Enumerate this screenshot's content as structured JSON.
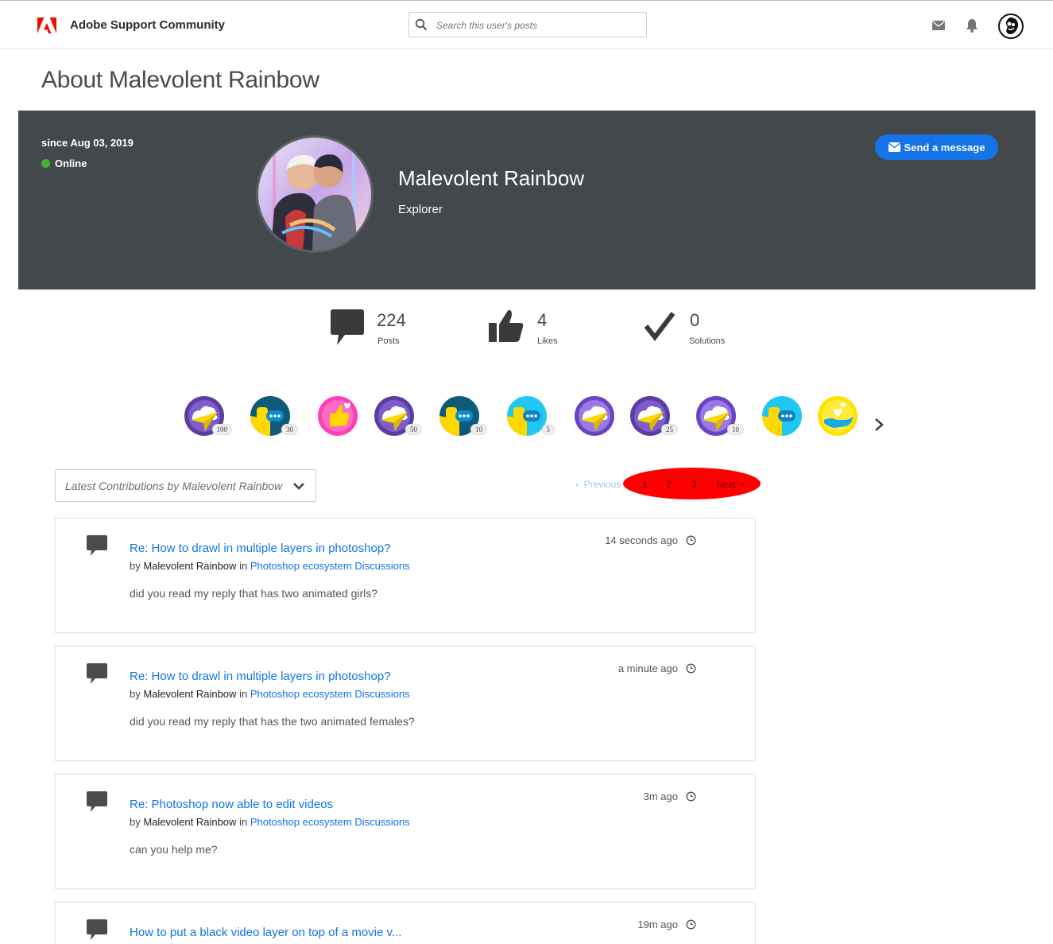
{
  "header": {
    "brand": "Adobe Support Community",
    "search_placeholder": "Search this user's posts"
  },
  "page_title": "About Malevolent Rainbow",
  "profile": {
    "since": "since Aug 03, 2019",
    "status": "Online",
    "name": "Malevolent Rainbow",
    "rank": "Explorer",
    "send_message": "Send a message"
  },
  "stats": [
    {
      "value": "224",
      "label": "Posts"
    },
    {
      "value": "4",
      "label": "Likes"
    },
    {
      "value": "0",
      "label": "Solutions"
    }
  ],
  "badges": [
    {
      "icon": "paper-plane-icon",
      "count": "100"
    },
    {
      "icon": "chat-bubble-icon",
      "count": "30"
    },
    {
      "icon": "thumbs-up-heart-icon",
      "count": ""
    },
    {
      "icon": "paper-plane-icon",
      "count": "50"
    },
    {
      "icon": "chat-bubble-icon",
      "count": "10"
    },
    {
      "icon": "chat-bubble-icon",
      "count": "5"
    },
    {
      "icon": "paper-plane-icon",
      "count": ""
    },
    {
      "icon": "paper-plane-icon",
      "count": "25"
    },
    {
      "icon": "paper-plane-icon",
      "count": "10"
    },
    {
      "icon": "chat-bubble-icon",
      "count": ""
    },
    {
      "icon": "helping-hand-icon",
      "count": ""
    }
  ],
  "filter": {
    "label": "Latest Contributions by Malevolent Rainbow"
  },
  "pagination": {
    "prev": "Previous",
    "pages": [
      "1",
      "2",
      "3"
    ],
    "next": "Next"
  },
  "contributions": [
    {
      "title": "Re: How to drawl in multiple layers in photoshop?",
      "by": "by",
      "author": "Malevolent Rainbow",
      "in": "in",
      "board": "Photoshop ecosystem Discussions",
      "excerpt": "did you read my reply that has two animated girls?",
      "time": "14 seconds ago"
    },
    {
      "title": "Re: How to drawl in multiple layers in photoshop?",
      "by": "by",
      "author": "Malevolent Rainbow",
      "in": "in",
      "board": "Photoshop ecosystem Discussions",
      "excerpt": "did you read my reply that has the two animated females?",
      "time": "a minute ago"
    },
    {
      "title": "Re: Photoshop now able to edit videos",
      "by": "by",
      "author": "Malevolent Rainbow",
      "in": "in",
      "board": "Photoshop ecosystem Discussions",
      "excerpt": "can you help me?",
      "time": "3m ago"
    },
    {
      "title": "How to put a black video layer on top of a movie v...",
      "time": "19m ago"
    }
  ],
  "colors": {
    "accent": "#1473e6",
    "banner": "#43484d",
    "online": "#44b02f",
    "adobe_red": "#eb1000"
  }
}
